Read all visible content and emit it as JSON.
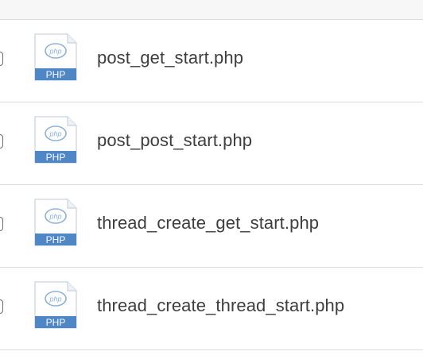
{
  "files": [
    {
      "name": "post_get_start.php",
      "icon": "php-file-icon",
      "icon_label": "PHP",
      "icon_badge": "php"
    },
    {
      "name": "post_post_start.php",
      "icon": "php-file-icon",
      "icon_label": "PHP",
      "icon_badge": "php"
    },
    {
      "name": "thread_create_get_start.php",
      "icon": "php-file-icon",
      "icon_label": "PHP",
      "icon_badge": "php"
    },
    {
      "name": "thread_create_thread_start.php",
      "icon": "php-file-icon",
      "icon_label": "PHP",
      "icon_badge": "php"
    }
  ],
  "colors": {
    "icon_band": "#4f86c6",
    "icon_outline": "#c9d3e0",
    "divider": "#dcdcdc",
    "text": "#3e3e3e"
  }
}
